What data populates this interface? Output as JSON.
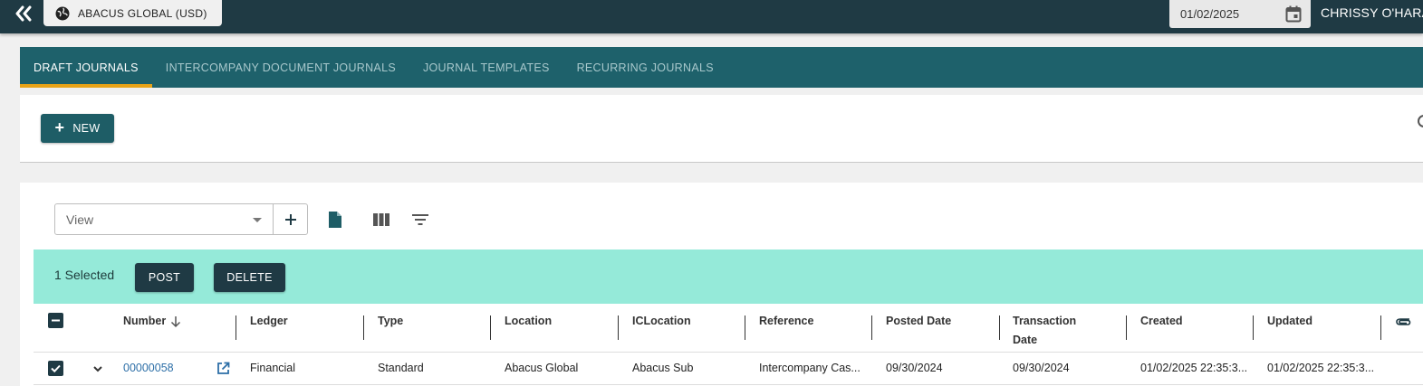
{
  "topbar": {
    "entity_label": "ABACUS GLOBAL (USD)",
    "date_value": "01/02/2025",
    "user_name": "CHRISSY O'HARA"
  },
  "tabs": [
    {
      "label": "DRAFT JOURNALS",
      "active": true
    },
    {
      "label": "INTERCOMPANY DOCUMENT JOURNALS",
      "active": false
    },
    {
      "label": "JOURNAL TEMPLATES",
      "active": false
    },
    {
      "label": "RECURRING JOURNALS",
      "active": false
    }
  ],
  "actions": {
    "new_label": "NEW"
  },
  "grid": {
    "view_placeholder": "View",
    "selection_text": "1 Selected",
    "post_label": "POST",
    "delete_label": "DELETE",
    "columns": {
      "number": "Number",
      "ledger": "Ledger",
      "type": "Type",
      "location": "Location",
      "iclocation": "ICLocation",
      "reference": "Reference",
      "posted_date": "Posted Date",
      "transaction_date_1": "Transaction",
      "transaction_date_2": "Date",
      "created": "Created",
      "updated": "Updated"
    },
    "rows": [
      {
        "number": "00000058",
        "ledger": "Financial",
        "type": "Standard",
        "location": "Abacus Global",
        "iclocation": "Abacus Sub",
        "reference": "Intercompany Cas...",
        "posted_date": "09/30/2024",
        "transaction_date": "09/30/2024",
        "created": "01/02/2025 22:35:3...",
        "updated": "01/02/2025 22:35:3...",
        "selected": true
      }
    ]
  },
  "colors": {
    "topbar": "#1f3a44",
    "tabbar": "#1e616b",
    "tab_indicator": "#e8a317",
    "selection_bar": "#95ead9",
    "link": "#2d6fa7"
  }
}
